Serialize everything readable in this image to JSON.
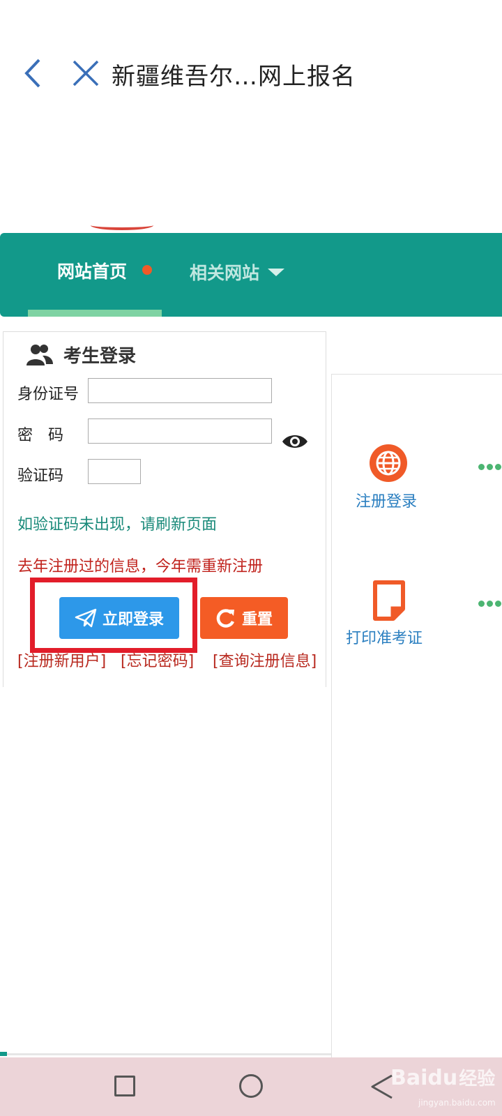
{
  "browser": {
    "title": "新疆维吾尔…网上报名"
  },
  "nav": {
    "home_label": "网站首页",
    "related_label": "相关网站",
    "accent_color": "#12998a",
    "dot_color": "#f05a28"
  },
  "login": {
    "title": "考生登录",
    "id_label": "身份证号",
    "id_value": "",
    "password_label": "密　码",
    "password_value": "",
    "captcha_label": "验证码",
    "captcha_value": "",
    "captcha_hint": "如验证码未出现，请刷新页面",
    "notice": "去年注册过的信息，今年需重新注册",
    "login_button": "立即登录",
    "reset_button": "重置",
    "link_register": "[注册新用户]",
    "link_forgot": "[忘记密码]",
    "link_query": "[查询注册信息]"
  },
  "side": {
    "register_label": "注册登录",
    "print_label": "打印准考证",
    "icon_color": "#f05a28"
  },
  "watermark": {
    "brand": "Baidu",
    "suffix": "经验",
    "url": "jingyan.baidu.com"
  }
}
